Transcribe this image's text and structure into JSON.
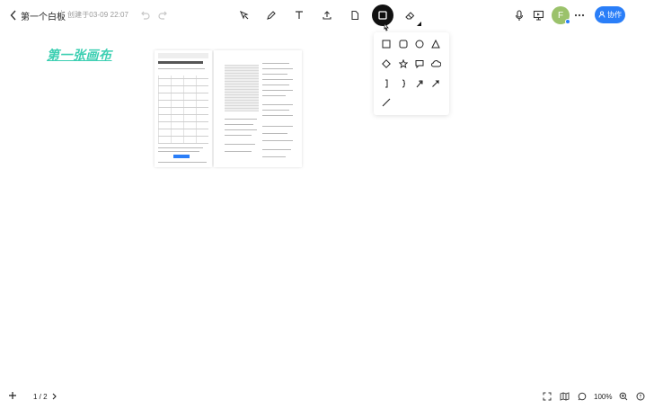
{
  "header": {
    "title": "第一个白板",
    "created": "创建于03-09 22:07"
  },
  "toolbar": {
    "tools": [
      {
        "name": "select-icon"
      },
      {
        "name": "pen-icon"
      },
      {
        "name": "text-icon"
      },
      {
        "name": "upload-icon"
      },
      {
        "name": "file-icon"
      },
      {
        "name": "rectangle-icon",
        "active": true
      },
      {
        "name": "eraser-icon"
      }
    ]
  },
  "account": {
    "avatar_letter": "F",
    "collab_label": "协作"
  },
  "canvas": {
    "title": "第一张画布"
  },
  "shape_panel": {
    "shapes": [
      "square-shape",
      "rounded-square-shape",
      "circle-shape",
      "triangle-shape",
      "diamond-shape",
      "star-shape",
      "speech-bubble-shape",
      "cloud-shape",
      "bracket-shape",
      "brace-shape",
      "curved-arrow-shape",
      "arrow-shape",
      "line-shape"
    ]
  },
  "footer": {
    "page_indicator": "1 / 2",
    "zoom": "100%"
  },
  "colors": {
    "accent": "#2a7ef8",
    "canvas_title": "#3ccfb2",
    "active_tool_bg": "#111111"
  }
}
